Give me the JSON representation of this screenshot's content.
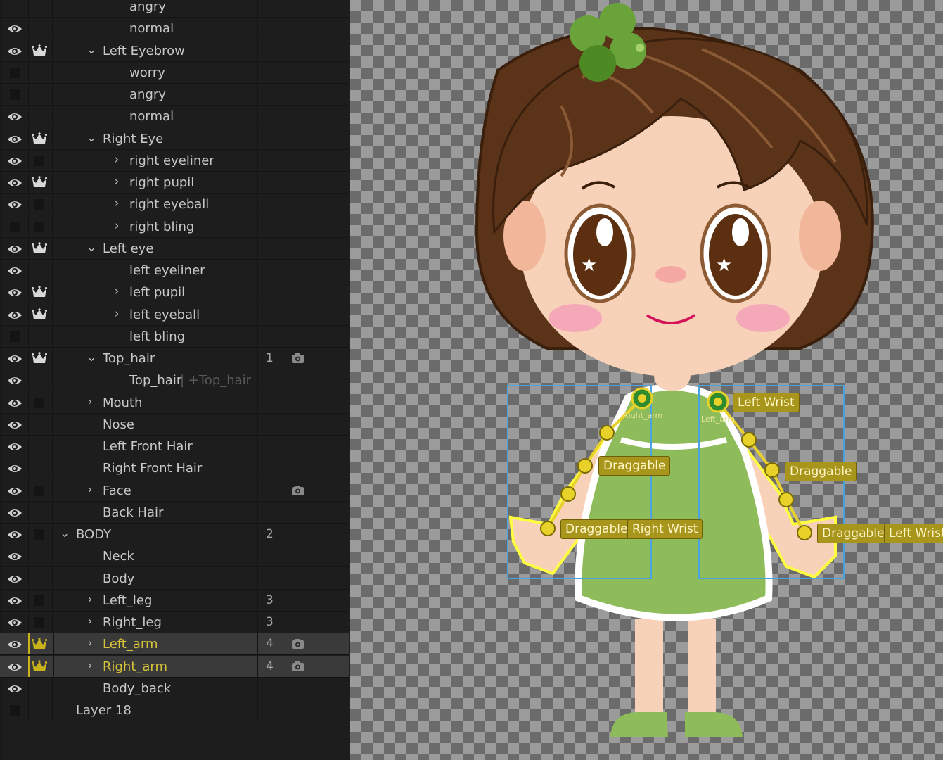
{
  "layers": [
    {
      "label": "angry",
      "indent": 4,
      "eye": false,
      "crown": false,
      "box": false,
      "box2": false,
      "chevron": "",
      "num": "",
      "camera": false,
      "extra": ""
    },
    {
      "label": "normal",
      "indent": 4,
      "eye": true,
      "crown": false,
      "box": false,
      "box2": false,
      "chevron": "",
      "num": "",
      "camera": false,
      "extra": ""
    },
    {
      "label": "Left Eyebrow",
      "indent": 3,
      "eye": true,
      "crown": true,
      "box": false,
      "box2": false,
      "chevron": "down",
      "num": "",
      "camera": false,
      "extra": ""
    },
    {
      "label": "worry",
      "indent": 4,
      "eye": false,
      "crown": false,
      "box": true,
      "box2": false,
      "chevron": "",
      "num": "",
      "camera": false,
      "extra": ""
    },
    {
      "label": "angry",
      "indent": 4,
      "eye": false,
      "crown": false,
      "box": true,
      "box2": false,
      "chevron": "",
      "num": "",
      "camera": false,
      "extra": ""
    },
    {
      "label": "normal",
      "indent": 4,
      "eye": true,
      "crown": false,
      "box": false,
      "box2": false,
      "chevron": "",
      "num": "",
      "camera": false,
      "extra": ""
    },
    {
      "label": "Right Eye",
      "indent": 3,
      "eye": true,
      "crown": true,
      "box": false,
      "box2": false,
      "chevron": "down",
      "num": "",
      "camera": false,
      "extra": ""
    },
    {
      "label": "right eyeliner",
      "indent": 4,
      "eye": true,
      "crown": false,
      "box": false,
      "box2": true,
      "chevron": "right",
      "num": "",
      "camera": false,
      "extra": ""
    },
    {
      "label": "right pupil",
      "indent": 4,
      "eye": true,
      "crown": true,
      "box": false,
      "box2": false,
      "chevron": "right",
      "num": "",
      "camera": false,
      "extra": ""
    },
    {
      "label": "right eyeball",
      "indent": 4,
      "eye": true,
      "crown": false,
      "box": false,
      "box2": true,
      "chevron": "right",
      "num": "",
      "camera": false,
      "extra": ""
    },
    {
      "label": "right bling",
      "indent": 4,
      "eye": false,
      "crown": false,
      "box": true,
      "box2": true,
      "chevron": "right",
      "num": "",
      "camera": false,
      "extra": ""
    },
    {
      "label": "Left eye",
      "indent": 3,
      "eye": true,
      "crown": true,
      "box": false,
      "box2": false,
      "chevron": "down",
      "num": "",
      "camera": false,
      "extra": ""
    },
    {
      "label": "left eyeliner",
      "indent": 4,
      "eye": true,
      "crown": false,
      "box": false,
      "box2": false,
      "chevron": "",
      "num": "",
      "camera": false,
      "extra": ""
    },
    {
      "label": "left pupil",
      "indent": 4,
      "eye": true,
      "crown": true,
      "box": false,
      "box2": false,
      "chevron": "right",
      "num": "",
      "camera": false,
      "extra": ""
    },
    {
      "label": "left eyeball",
      "indent": 4,
      "eye": true,
      "crown": true,
      "box": false,
      "box2": false,
      "chevron": "right",
      "num": "",
      "camera": false,
      "extra": ""
    },
    {
      "label": "left bling",
      "indent": 4,
      "eye": false,
      "crown": false,
      "box": true,
      "box2": false,
      "chevron": "",
      "num": "",
      "camera": false,
      "extra": ""
    },
    {
      "label": "Top_hair",
      "indent": 3,
      "eye": true,
      "crown": true,
      "box": false,
      "box2": false,
      "chevron": "down",
      "num": "1",
      "camera": true,
      "extra": ""
    },
    {
      "label": "Top_hair",
      "indent": 4,
      "eye": true,
      "crown": false,
      "box": false,
      "box2": false,
      "chevron": "",
      "num": "",
      "camera": false,
      "extra": " | +Top_hair"
    },
    {
      "label": "Mouth",
      "indent": 3,
      "eye": true,
      "crown": false,
      "box": false,
      "box2": true,
      "chevron": "right",
      "num": "",
      "camera": false,
      "extra": ""
    },
    {
      "label": "Nose",
      "indent": 3,
      "eye": true,
      "crown": false,
      "box": false,
      "box2": false,
      "chevron": "",
      "num": "",
      "camera": false,
      "extra": ""
    },
    {
      "label": "Left Front Hair",
      "indent": 3,
      "eye": true,
      "crown": false,
      "box": false,
      "box2": false,
      "chevron": "",
      "num": "",
      "camera": false,
      "extra": ""
    },
    {
      "label": "Right Front Hair",
      "indent": 3,
      "eye": true,
      "crown": false,
      "box": false,
      "box2": false,
      "chevron": "",
      "num": "",
      "camera": false,
      "extra": ""
    },
    {
      "label": "Face",
      "indent": 3,
      "eye": true,
      "crown": false,
      "box": false,
      "box2": true,
      "chevron": "right",
      "num": "",
      "camera": true,
      "extra": ""
    },
    {
      "label": "Back Hair",
      "indent": 3,
      "eye": true,
      "crown": false,
      "box": false,
      "box2": false,
      "chevron": "",
      "num": "",
      "camera": false,
      "extra": ""
    },
    {
      "label": "BODY",
      "indent": 2,
      "eye": true,
      "crown": false,
      "box": false,
      "box2": true,
      "chevron": "down",
      "num": "2",
      "camera": false,
      "extra": ""
    },
    {
      "label": "Neck",
      "indent": 3,
      "eye": true,
      "crown": false,
      "box": false,
      "box2": false,
      "chevron": "",
      "num": "",
      "camera": false,
      "extra": ""
    },
    {
      "label": "Body",
      "indent": 3,
      "eye": true,
      "crown": false,
      "box": false,
      "box2": false,
      "chevron": "",
      "num": "",
      "camera": false,
      "extra": ""
    },
    {
      "label": "Left_leg",
      "indent": 3,
      "eye": true,
      "crown": false,
      "box": false,
      "box2": true,
      "chevron": "right",
      "num": "3",
      "camera": false,
      "extra": ""
    },
    {
      "label": "Right_leg",
      "indent": 3,
      "eye": true,
      "crown": false,
      "box": false,
      "box2": true,
      "chevron": "right",
      "num": "3",
      "camera": false,
      "extra": ""
    },
    {
      "label": "Left_arm",
      "indent": 3,
      "eye": true,
      "crown": true,
      "box": false,
      "box2": false,
      "chevron": "right",
      "num": "4",
      "camera": true,
      "extra": "",
      "selected": true
    },
    {
      "label": "Right_arm",
      "indent": 3,
      "eye": true,
      "crown": true,
      "box": false,
      "box2": false,
      "chevron": "right",
      "num": "4",
      "camera": true,
      "extra": "",
      "selected": true
    },
    {
      "label": "Body_back",
      "indent": 3,
      "eye": true,
      "crown": false,
      "box": false,
      "box2": false,
      "chevron": "",
      "num": "",
      "camera": false,
      "extra": ""
    },
    {
      "label": "Layer 18",
      "indent": 2,
      "eye": false,
      "crown": false,
      "box": true,
      "box2": false,
      "chevron": "",
      "num": "",
      "camera": false,
      "extra": ""
    }
  ],
  "canvas": {
    "handles": {
      "draggable": "Draggable",
      "right_wrist": "Right Wrist",
      "left_wrist": "Left Wrist",
      "right_arm_group": "Right_arm",
      "left_arm_group": "Left_arm"
    }
  },
  "colors": {
    "accent": "#c9b21a",
    "panel_bg": "#1d1d1d",
    "selected_row": "#3a3a3a",
    "hair": "#5b3319",
    "dress": "#8fbc5a",
    "skin": "#f7d2b8"
  }
}
